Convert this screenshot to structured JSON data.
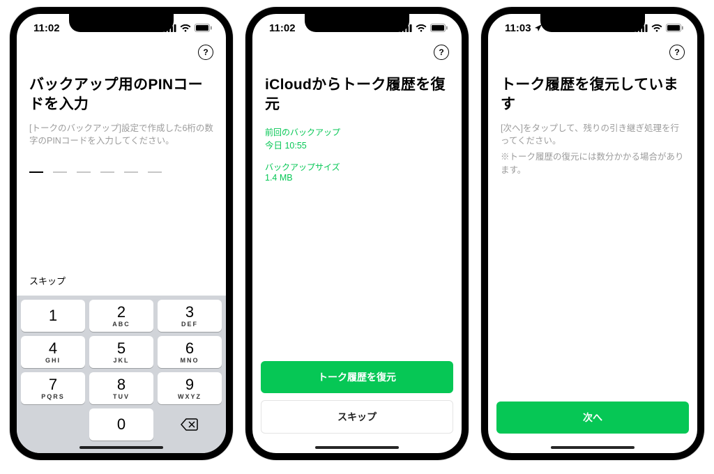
{
  "screens": [
    {
      "statusbar": {
        "time": "11:02",
        "location_arrow": false
      },
      "title": "バックアップ用のPINコードを入力",
      "desc": "[トークのバックアップ]設定で作成した6桁の数字のPINコードを入力してください。",
      "pin_slots": 6,
      "pin_active_index": 0,
      "skip_label": "スキップ",
      "keypad": {
        "keys": [
          {
            "num": "1",
            "sub": ""
          },
          {
            "num": "2",
            "sub": "ABC"
          },
          {
            "num": "3",
            "sub": "DEF"
          },
          {
            "num": "4",
            "sub": "GHI"
          },
          {
            "num": "5",
            "sub": "JKL"
          },
          {
            "num": "6",
            "sub": "MNO"
          },
          {
            "num": "7",
            "sub": "PQRS"
          },
          {
            "num": "8",
            "sub": "TUV"
          },
          {
            "num": "9",
            "sub": "WXYZ"
          }
        ],
        "zero": "0"
      }
    },
    {
      "statusbar": {
        "time": "11:02",
        "location_arrow": false
      },
      "title": "iCloudからトーク履歴を復元",
      "backup": {
        "last_label": "前回のバックアップ",
        "last_value": "今日 10:55",
        "size_label": "バックアップサイズ",
        "size_value": "1.4 MB"
      },
      "primary_btn": "トーク履歴を復元",
      "secondary_btn": "スキップ"
    },
    {
      "statusbar": {
        "time": "11:03",
        "location_arrow": true
      },
      "title": "トーク履歴を復元しています",
      "desc_line1": "[次へ]をタップして、残りの引き継ぎ処理を行ってください。",
      "desc_line2": "※トーク履歴の復元には数分かかる場合があります。",
      "primary_btn": "次へ"
    }
  ],
  "help_glyph": "?"
}
